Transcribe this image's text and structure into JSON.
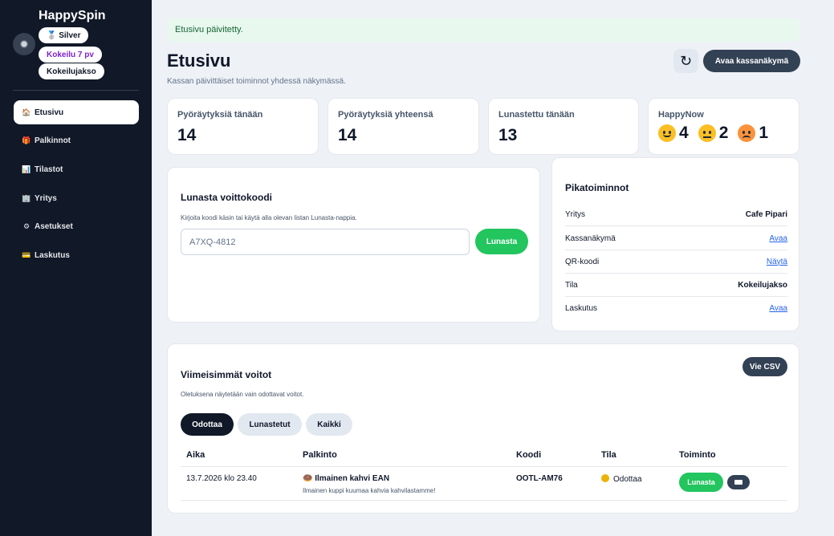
{
  "sidebar": {
    "brand": "HappySpin",
    "badges": {
      "plan": "🥈 Silver",
      "trial": "Kokeilu 7 pv",
      "status": "Kokeilujakso"
    },
    "items": [
      {
        "icon": "🏠",
        "label": "Etusivu"
      },
      {
        "icon": "🎁",
        "label": "Palkinnot"
      },
      {
        "icon": "📊",
        "label": "Tilastot"
      },
      {
        "icon": "🏢",
        "label": "Yritys"
      },
      {
        "icon": "⚙",
        "label": "Asetukset"
      },
      {
        "icon": "💳",
        "label": "Laskutus"
      }
    ],
    "active_item": "Etusivu"
  },
  "toast": "Etusivu päivitetty.",
  "header": {
    "title": "Etusivu",
    "subtitle": "Kassan päivittäiset toiminnot yhdessä näkymässä.",
    "refresh_icon": "↻",
    "open_pos_label": "Avaa kassanäkymä"
  },
  "stats": [
    {
      "label": "Pyöräytyksiä tänään",
      "value": "14"
    },
    {
      "label": "Pyöräytyksiä yhteensä",
      "value": "14"
    },
    {
      "label": "Lunastettu tänään",
      "value": "13"
    }
  ],
  "happy_now": {
    "label": "HappyNow",
    "happy": "4",
    "neutral": "2",
    "sad": "1"
  },
  "redeem": {
    "title": "Lunasta voittokoodi",
    "hint": "Kirjoita koodi käsin tai käytä alla olevan listan Lunasta-nappia.",
    "placeholder": "A7XQ-4812",
    "button": "Lunasta"
  },
  "quick_actions": {
    "title": "Pikatoiminnot",
    "rows": [
      {
        "label": "Yritys",
        "value": "Cafe Pipari"
      },
      {
        "label": "Kassanäkymä",
        "value": "Avaa"
      },
      {
        "label": "QR-koodi",
        "value": "Näytä"
      },
      {
        "label": "Tila",
        "value": "Kokeilujakso"
      },
      {
        "label": "Laskutus",
        "value": "Avaa"
      }
    ]
  },
  "recent_wins": {
    "title": "Viimeisimmät voitot",
    "hint": "Oletuksena näytetään vain odottavat voitot.",
    "csv_button": "Vie CSV",
    "tabs": [
      "Odottaa",
      "Lunastetut",
      "Kaikki"
    ],
    "active_tab": "Odottaa",
    "columns": [
      "Aika",
      "Palkinto",
      "Koodi",
      "Tila",
      "Toiminto"
    ],
    "rows": [
      {
        "time": "13.7.2026 klo 23.40",
        "prize_icon": "🍩",
        "prize": "Ilmainen kahvi EAN",
        "prize_desc": "Ilmainen kuppi kuumaa kahvia kahvilastamme!",
        "code": "OOTL-AM76",
        "status": "Odottaa",
        "action": "Lunasta"
      }
    ]
  }
}
